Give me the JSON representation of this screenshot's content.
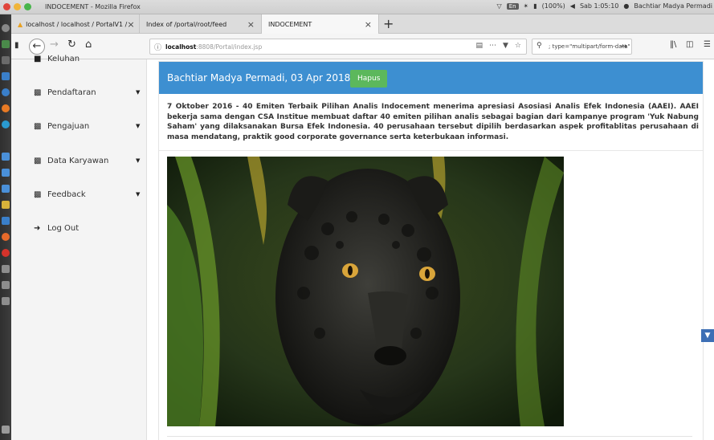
{
  "os": {
    "window_title": "INDOCEMENT - Mozilla Firefox",
    "lang": "En",
    "battery": "(100%)",
    "clock": "Sab 1:05:10",
    "user": "Bachtiar Madya Permadi"
  },
  "browser": {
    "tabs": [
      {
        "label": "localhost / localhost / PortalV1 / "
      },
      {
        "label": "Index of /portal/root/feed"
      },
      {
        "label": "INDOCEMENT"
      }
    ],
    "url_host": "localhost",
    "url_rest": ":8808/Portal/index.jsp",
    "search_text": "; type=\"multipart/form-data\""
  },
  "sidebar": {
    "items": [
      {
        "label": "Keluhan"
      },
      {
        "label": "Pendaftaran"
      },
      {
        "label": "Pengajuan"
      },
      {
        "label": "Data Karyawan"
      },
      {
        "label": "Feedback"
      },
      {
        "label": "Log Out"
      }
    ]
  },
  "post": {
    "header": "Bachtiar Madya Permadi, 03 Apr 2018",
    "delete_label": "Hapus",
    "body": "7 Oktober 2016 - 40 Emiten Terbaik Pilihan Analis Indocement menerima apresiasi Asosiasi Analis Efek Indonesia (AAEI). AAEI bekerja sama dengan CSA Institue membuat daftar 40 emiten pilihan analis sebagai bagian dari kampanye program 'Yuk Nabung Saham' yang dilaksanakan Bursa Efek Indonesia. 40 perusahaan tersebut dipilih berdasarkan aspek profitablitas perusahaan di masa mendatang, praktik good corporate governance serta keterbukaan informasi."
  },
  "colors": {
    "header_blue": "#3d8fd1",
    "button_green": "#5cb85c"
  }
}
